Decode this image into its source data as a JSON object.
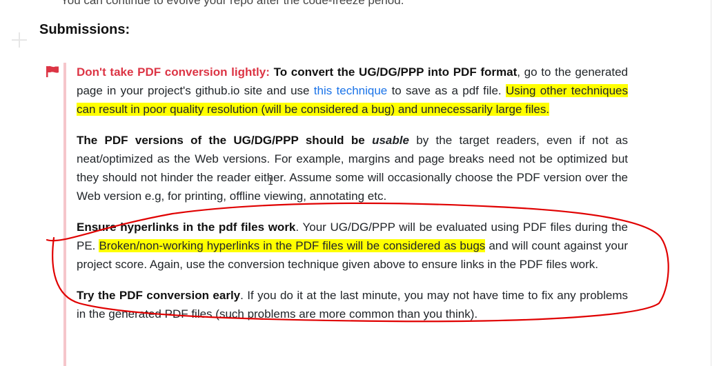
{
  "top_text": "You can continue to evolve your repo after the code-freeze period.",
  "heading": "Submissions:",
  "callout": {
    "flag_icon": "flag-icon",
    "flag_color": "#dc3545",
    "p1": {
      "warn": "Don't take PDF conversion lightly:",
      "bold": "To convert the UG/DG/PPP into PDF format",
      "text1": ", go to the generated page in your project's github.io site and use ",
      "link": "this technique",
      "text2": " to save as a pdf file. ",
      "highlight": "Using other techniques can result in poor quality resolution (will be considered a bug) and unnecessarily large files."
    },
    "p2": {
      "bold1": "The PDF versions of the UG/DG/PPP should be ",
      "emph": "usable",
      "text": " by the target readers, even if not as neat/optimized as the Web versions. For example, margins and page breaks need not be optimized but they should not hinder the reader either. Assume some will occasionally choose the PDF version over the Web version e.g, for printing, offline viewing, annotating etc."
    },
    "p3": {
      "bold": "Ensure hyperlinks in the pdf files work",
      "text1": ". Your UG/DG/PPP will be evaluated using PDF files during the PE. ",
      "highlight": "Broken/non-working hyperlinks in the PDF files will be considered as bugs",
      "text2": " and will count against your project score. Again, use the conversion technique given above to ensure links in the PDF files work."
    },
    "p4": {
      "bold": "Try the PDF conversion early",
      "text": ". If you do it at the last minute, you may not have time to fix any problems in the generated PDF files (such problems are more common than you think)."
    }
  },
  "colors": {
    "highlight": "#ffff00",
    "link": "#1a73e8",
    "warning": "#dc3545",
    "annotation": "#e00000"
  }
}
